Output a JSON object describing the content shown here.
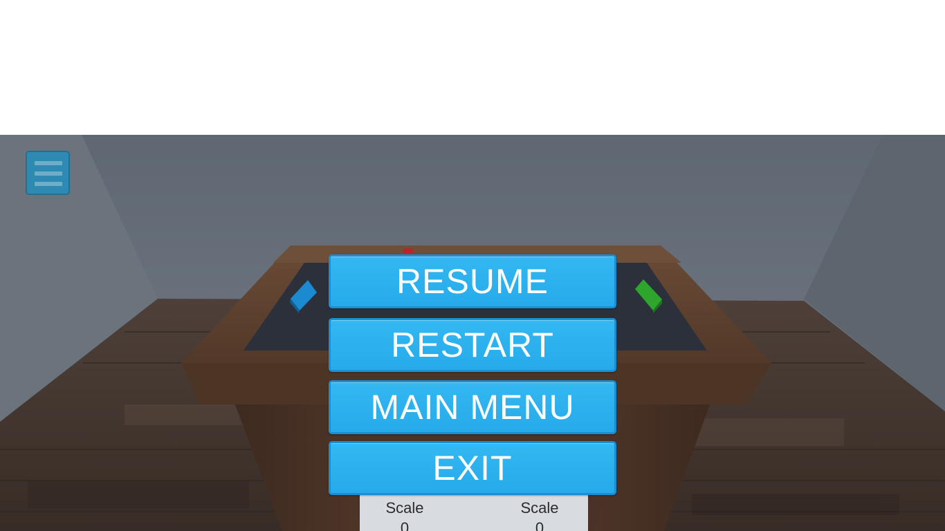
{
  "menu": {
    "resume_label": "RESUME",
    "restart_label": "RESTART",
    "main_menu_label": "MAIN MENU",
    "exit_label": "EXIT"
  },
  "hud": {
    "hamburger_icon": "hamburger-menu-icon",
    "left_scale_label": "Scale",
    "left_scale_value": "0",
    "right_scale_label": "Scale",
    "right_scale_value": "0"
  },
  "colors": {
    "button_fill": "#2ab3ef",
    "button_border": "#1a8fd3",
    "left_paddle": "#1b8ad0",
    "right_paddle": "#2ea62e",
    "ball": "#c0202a",
    "wall": "#66707a",
    "floor": "#4a3c33",
    "table_wood": "#5a4030",
    "table_surface": "#2b2f3a"
  }
}
